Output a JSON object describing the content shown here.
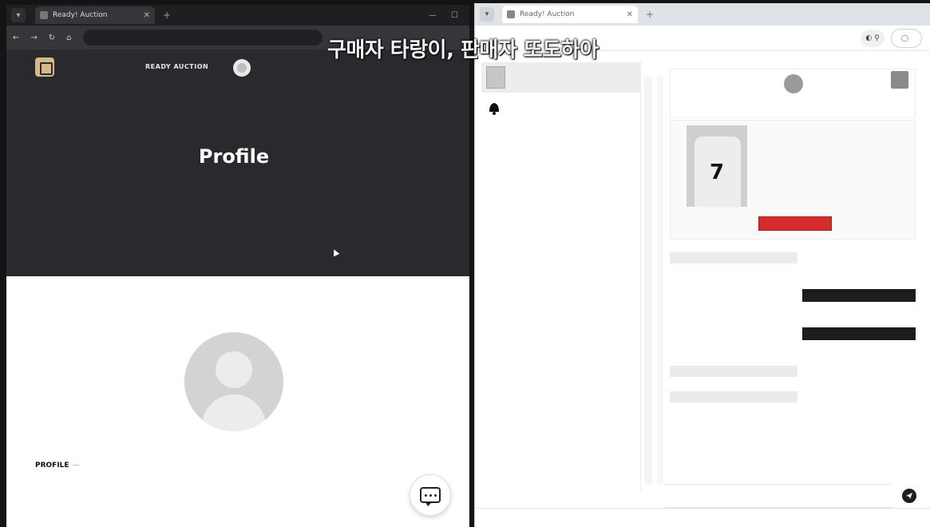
{
  "caption": "구매자 타랑이, 판매자 또도하아",
  "left_window": {
    "tab_title": "Ready! Auction",
    "url": "",
    "site_badge": "",
    "nav_brand": "READY AUCTION",
    "hero_title": "Profile",
    "hero_crumb": "",
    "profile_label": "PROFILE",
    "profile_dash": "—",
    "field1": "",
    "field2": "",
    "right_note": ""
  },
  "right_window": {
    "tab_title": "Ready! Auction",
    "url": "",
    "pill_label": "",
    "chat_list_title": "",
    "chat_items": [
      {
        "name": "",
        "sub": ""
      },
      {
        "name": "",
        "sub": ""
      }
    ],
    "seller_name": "",
    "product": {
      "title": "",
      "price": "",
      "info": "",
      "bid_button": ""
    },
    "messages": [
      {
        "side": "in",
        "text": "",
        "time": ""
      },
      {
        "side": "out",
        "text": "",
        "time": ""
      },
      {
        "side": "out",
        "text": "",
        "time": ""
      },
      {
        "side": "in",
        "text": "",
        "time": ""
      },
      {
        "side": "in",
        "text": "",
        "time": ""
      }
    ],
    "input_placeholder": ""
  },
  "colors": {
    "hero_bg": "#2a2a2e",
    "bid_red": "#d62b2b",
    "out_bubble": "#1d1d1d"
  },
  "icons": [
    "menu-icon",
    "back-icon",
    "forward-icon",
    "reload-icon",
    "home-icon",
    "chat-bubble-icon",
    "send-icon",
    "bell-icon",
    "avatar-icon"
  ]
}
